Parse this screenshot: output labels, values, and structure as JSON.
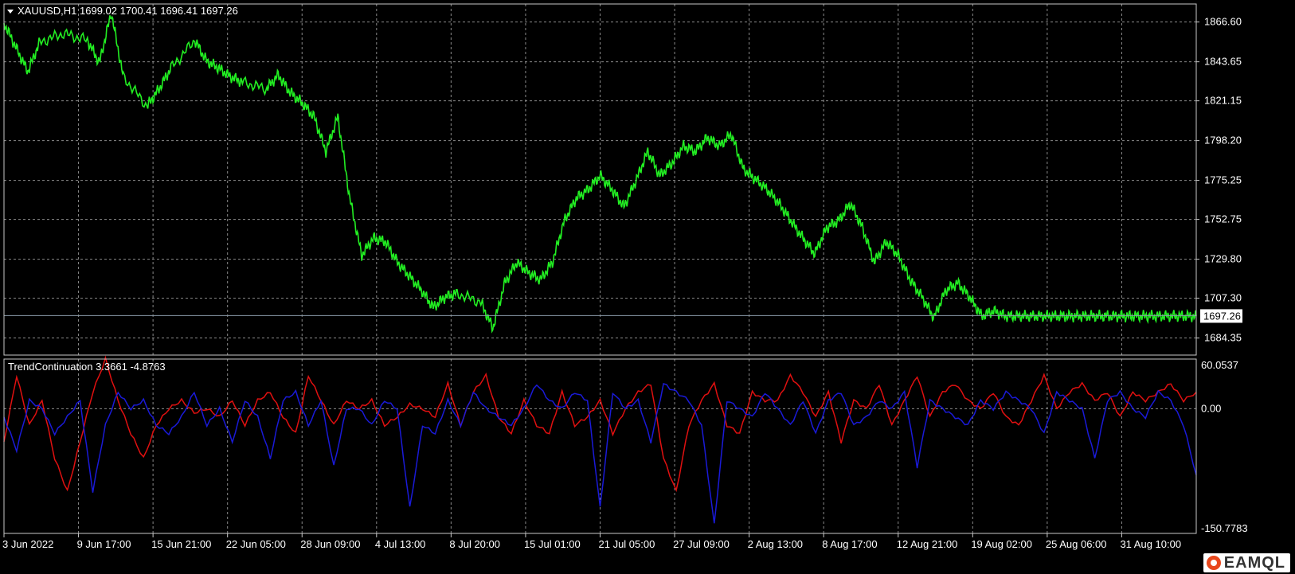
{
  "window": {
    "price_header": "XAUUSD,H1  1699.02 1700.41 1696.41 1697.26",
    "indicator_header": "TrendContinuation 3.3661 -4.8763"
  },
  "colors": {
    "background": "#000000",
    "grid": "#8a8a8a",
    "price_line": "#22ee22",
    "ind_positive": "#e01010",
    "ind_negative": "#1a1ad8",
    "current_price_line": "#8a9aa8"
  },
  "brand": {
    "label": "EAMQL",
    "icon": "eamql-logo-icon"
  },
  "chart_data": [
    {
      "type": "line",
      "series": [
        {
          "x": [
            0,
            0.01,
            0.02,
            0.03,
            0.05,
            0.07,
            0.08,
            0.09,
            0.1,
            0.12,
            0.13,
            0.14,
            0.16,
            0.17,
            0.18,
            0.19,
            0.2,
            0.22,
            0.23,
            0.24,
            0.25,
            0.26,
            0.27,
            0.28,
            0.29,
            0.3,
            0.31,
            0.32,
            0.33,
            0.34,
            0.35,
            0.36,
            0.37,
            0.38,
            0.4,
            0.41,
            0.42,
            0.43,
            0.44,
            0.45,
            0.46,
            0.47,
            0.48,
            0.49,
            0.5,
            0.51,
            0.52,
            0.53,
            0.54,
            0.55,
            0.56,
            0.57,
            0.58,
            0.59,
            0.6,
            0.61,
            0.62,
            0.63,
            0.64,
            0.65,
            0.66,
            0.67,
            0.68,
            0.69,
            0.7,
            0.71,
            0.72,
            0.73,
            0.74,
            0.75,
            0.76,
            0.77,
            0.78,
            0.79,
            0.8,
            0.81,
            0.82,
            0.83,
            0.84,
            0.85,
            0.86,
            0.87,
            0.88,
            0.89,
            0.9,
            0.91,
            0.92,
            0.93,
            0.94,
            0.95,
            0.96,
            0.97,
            0.98,
            0.99,
            1.0
          ],
          "y": [
            1866,
            1852,
            1838,
            1855,
            1860,
            1856,
            1843,
            1872,
            1835,
            1818,
            1828,
            1840,
            1856,
            1844,
            1840,
            1835,
            1832,
            1828,
            1836,
            1826,
            1820,
            1812,
            1792,
            1812,
            1765,
            1732,
            1742,
            1740,
            1728,
            1720,
            1712,
            1702,
            1708,
            1710,
            1705,
            1690,
            1716,
            1728,
            1722,
            1718,
            1728,
            1752,
            1765,
            1770,
            1778,
            1770,
            1760,
            1775,
            1792,
            1778,
            1785,
            1795,
            1792,
            1800,
            1795,
            1802,
            1782,
            1776,
            1770,
            1762,
            1752,
            1742,
            1733,
            1748,
            1752,
            1762,
            1748,
            1728,
            1740,
            1732,
            1718,
            1708,
            1696,
            1712,
            1716,
            1708,
            1697,
            1700,
            1697,
            1697,
            1697,
            1697,
            1697,
            1697,
            1697,
            1697,
            1697,
            1697,
            1697,
            1697,
            1697,
            1697,
            1697,
            1697,
            1697
          ]
        }
      ],
      "ylim": [
        1674.5,
        1877
      ],
      "y_ticks": [
        1866.6,
        1843.65,
        1821.15,
        1798.2,
        1775.25,
        1752.75,
        1729.8,
        1707.3,
        1684.35
      ],
      "y_tick_labels": [
        "1866.60",
        "1843.65",
        "1821.15",
        "1798.20",
        "1775.25",
        "1752.75",
        "1729.80",
        "1707.30",
        "1684.35"
      ],
      "current_price": 1697.26,
      "current_price_label": "1697.26",
      "grid": true
    },
    {
      "type": "line",
      "series": [
        {
          "color_key": "ind_positive",
          "y": [
            -40,
            40,
            -20,
            10,
            -60,
            -100,
            -40,
            20,
            60,
            10,
            -30,
            -60,
            -20,
            0,
            10,
            -5,
            0,
            -10,
            10,
            -20,
            10,
            20,
            -10,
            -30,
            40,
            10,
            -20,
            10,
            0,
            10,
            -20,
            -10,
            5,
            0,
            -10,
            30,
            -20,
            20,
            40,
            -10,
            -30,
            10,
            -20,
            -30,
            20,
            -20,
            -10,
            10,
            -30,
            0,
            20,
            30,
            -60,
            -100,
            -20,
            10,
            30,
            -20,
            -30,
            20,
            10,
            10,
            40,
            20,
            -10,
            20,
            -40,
            10,
            0,
            30,
            -20,
            10,
            40,
            -10,
            20,
            30,
            10,
            0,
            20,
            -10,
            -20,
            10,
            40,
            0,
            20,
            30,
            10,
            20,
            -10,
            20,
            10,
            20,
            30,
            10,
            20
          ]
        },
        {
          "color_key": "ind_negative",
          "y": [
            -10,
            -50,
            10,
            0,
            -30,
            -10,
            10,
            -100,
            -20,
            20,
            0,
            10,
            -20,
            -30,
            -10,
            20,
            -20,
            0,
            -40,
            10,
            -10,
            -60,
            10,
            20,
            -20,
            10,
            -70,
            0,
            0,
            -20,
            10,
            0,
            -120,
            -20,
            -30,
            10,
            -20,
            20,
            0,
            -10,
            -20,
            0,
            30,
            10,
            0,
            20,
            10,
            -120,
            20,
            0,
            10,
            -40,
            30,
            20,
            10,
            -20,
            -140,
            10,
            0,
            -10,
            20,
            0,
            -20,
            10,
            -30,
            10,
            20,
            -20,
            -10,
            10,
            0,
            20,
            -70,
            10,
            0,
            -10,
            -20,
            10,
            0,
            20,
            10,
            0,
            -30,
            20,
            10,
            0,
            -60,
            10,
            20,
            0,
            -10,
            20,
            10,
            -20,
            -80
          ]
        }
      ],
      "ylim": [
        -150.7783,
        60.0537
      ],
      "y_ticks": [
        60.0537,
        0.0,
        -150.7783
      ],
      "y_tick_labels": [
        "60.0537",
        "0.00",
        "-150.7783"
      ],
      "grid": true
    }
  ],
  "x_axis": {
    "labels": [
      "3 Jun 2022",
      "9 Jun 17:00",
      "15 Jun 21:00",
      "22 Jun 05:00",
      "28 Jun 09:00",
      "4 Jul 13:00",
      "8 Jul 20:00",
      "15 Jul 01:00",
      "21 Jul 05:00",
      "27 Jul 09:00",
      "2 Aug 13:00",
      "8 Aug 17:00",
      "12 Aug 21:00",
      "19 Aug 02:00",
      "25 Aug 06:00",
      "31 Aug 10:00"
    ]
  }
}
